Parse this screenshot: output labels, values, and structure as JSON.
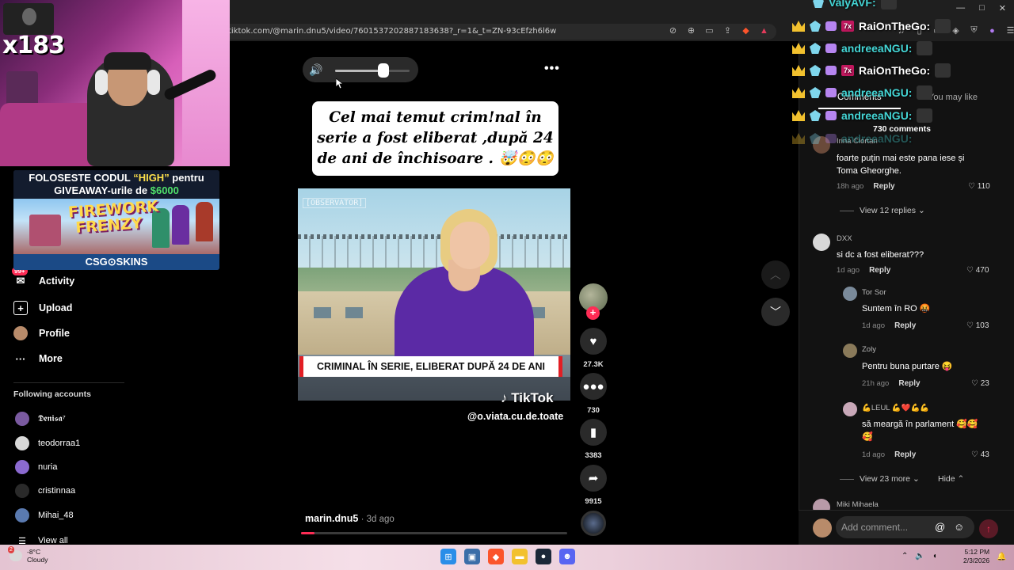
{
  "browser": {
    "url": "tiktok.com/@marin.dnu5/video/7601537202887183638?_r=1&_t=ZN-93cEfzh6l6w",
    "window_controls": [
      "—",
      "□",
      "✕"
    ]
  },
  "stream": {
    "follower_counter": "x183"
  },
  "sponsor": {
    "line1_a": "FOLOSESTE CODUL ",
    "line1_code": "“HIGH”",
    "line1_b": " pentru",
    "line2_a": "GIVEAWAY-urile de ",
    "line2_amount": "$6000",
    "game_title": "FIREWORK FRENZY",
    "brand": "CSG⊙SKINS"
  },
  "sidebar": {
    "nav": [
      {
        "label": "Activity",
        "badge": "99+"
      },
      {
        "label": "Upload"
      },
      {
        "label": "Profile"
      },
      {
        "label": "More"
      }
    ],
    "following_title": "Following accounts",
    "following": [
      {
        "name": "𝕯𝖊𝖓𝖎𝖘𝖆⁷",
        "color": "#7a5aa0"
      },
      {
        "name": "teodorraa1",
        "color": "#d8d8d8"
      },
      {
        "name": "nuria",
        "color": "#8b6ad0"
      },
      {
        "name": "cristinnaa",
        "color": "#2a2a2a"
      },
      {
        "name": "Mihai_48",
        "color": "#5a7ab0"
      }
    ],
    "view_all": "View all"
  },
  "video": {
    "volume_level": 0.65,
    "caption": "Cel mai temut crim!nal în serie a fost eliberat ,după 24 de ani de închisoare . 🤯😳😳",
    "channel_logo": "[OBSERVATOR]",
    "lower_third": "CRIMINAL ÎN SERIE, ELIBERAT DUPĂ 24 DE ANI",
    "watermark": "TikTok",
    "watermark_handle": "@o.viata.cu.de.toate",
    "author": "marin.dnu5",
    "posted": " · 3d ago",
    "progress": 0.05
  },
  "actions": {
    "likes": "27.3K",
    "comments": "730",
    "saves": "3383",
    "shares": "9915"
  },
  "comments_panel": {
    "tab_comments": "Comments",
    "tab_you_may_like": "You may like",
    "count": "730 comments",
    "items": [
      {
        "name": "Irina Ciortan",
        "text": "foarte puțin mai este pana iese și Toma Gheorghe.",
        "date": "18h ago",
        "reply": "Reply",
        "likes": "110",
        "av": "#6a4a3a"
      },
      {
        "name": "DXX",
        "text": "si dc a fost eliberat???",
        "date": "1d ago",
        "reply": "Reply",
        "likes": "470",
        "av": "#d8d8d8"
      },
      {
        "name": "Tor Sor",
        "text": "Suntem în RO 🤬",
        "date": "1d ago",
        "reply": "Reply",
        "likes": "103",
        "av": "#7a8a9a"
      },
      {
        "name": "Zoly",
        "text": "Pentru buna purtare 😝",
        "date": "21h ago",
        "reply": "Reply",
        "likes": "23",
        "av": "#8a7a5a"
      },
      {
        "name": "💪LEUL 💪❤️💪💪",
        "text": "să meargă în parlament 🥰🥰🥰",
        "date": "1d ago",
        "reply": "Reply",
        "likes": "43",
        "av": "#c8a8b8"
      },
      {
        "name": "Miki Mihaela",
        "av": "#b89aa8"
      }
    ],
    "view_replies_1": "View 12 replies",
    "view_more_2": "View 23 more",
    "hide": "Hide",
    "add_placeholder": "Add comment..."
  },
  "chat": [
    {
      "user": "ValyAVF:",
      "color": "#44d6d6"
    },
    {
      "user": "RaiOnTheGo:",
      "color": "#ffffff",
      "badge7": "7x"
    },
    {
      "user": "andreeaNGU:",
      "color": "#44d6d6"
    },
    {
      "user": "RaiOnTheGo:",
      "color": "#ffffff",
      "badge7": "7x"
    },
    {
      "user": "andreeaNGU:",
      "color": "#44d6d6"
    },
    {
      "user": "andreeaNGU:",
      "color": "#44d6d6"
    },
    {
      "user": "andreeaNGU:",
      "color": "#44d6d6"
    }
  ],
  "taskbar": {
    "temp": "-8°C",
    "weather": "Cloudy",
    "weather_badge": "2",
    "time": "5:12 PM",
    "date": "2/3/2026"
  }
}
